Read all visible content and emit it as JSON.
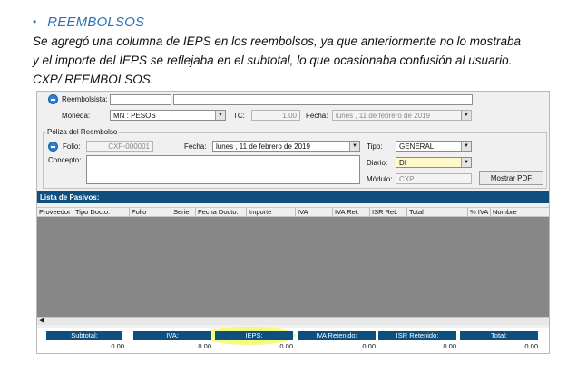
{
  "doc": {
    "bullet": "•",
    "heading": "REEMBOLSOS",
    "lines": [
      "Se agregó una columna de IEPS en los reembolsos, ya que anteriormente no lo mostraba",
      "y el importe del IEPS se reflejaba en el subtotal, lo que ocasionaba confusión al usuario.",
      "CXP/ REEMBOLSOS."
    ]
  },
  "app": {
    "reembolsista_label": "Reembolsista:",
    "moneda_label": "Moneda:",
    "moneda_value": "MN : PESOS",
    "tc_label": "TC:",
    "tc_value": "1.00",
    "fecha_label": "Fecha:",
    "fecha_top_value": "lunes   , 11 de   febrero   de 2019",
    "poliza_group": "Póliza del Reembolso",
    "folio_label": "Folio:",
    "folio_value": "CXP-000001",
    "fecha_poliza_label": "Fecha:",
    "fecha_poliza_value": "lunes   , 11 de   febrero   de 2019",
    "concepto_label": "Concepto:",
    "tipo_label": "Tipo:",
    "tipo_value": "GENERAL",
    "diario_label": "Diario:",
    "diario_value": "DI",
    "modulo_label": "Módulo:",
    "modulo_value": "CXP",
    "mostrar_pdf": "Mostrar PDF",
    "list_title": "Lista de Pasivos:",
    "columns": [
      "Proveedor",
      "Tipo Docto.",
      "Folio",
      "Serie",
      "Fecha Docto.",
      "Importe",
      "IVA",
      "IVA Ret.",
      "ISR Ret.",
      "Total",
      "% IVA",
      "Nombre"
    ],
    "totals": [
      {
        "label": "Subtotal:",
        "value": "0.00"
      },
      {
        "label": "IVA:",
        "value": "0.00"
      },
      {
        "label": "IEPS:",
        "value": "0.00"
      },
      {
        "label": "IVA Retenido:",
        "value": "0.00"
      },
      {
        "label": "ISR Retenido:",
        "value": "0.00"
      },
      {
        "label": "Total:",
        "value": "0.00"
      }
    ],
    "dropdown_glyph": "▼",
    "scroll_glyph": "◀"
  },
  "colors": {
    "heading": "#2e74b5",
    "header_bar": "#0f4f7e",
    "grid_body": "#878787",
    "highlight": "#eef514"
  }
}
